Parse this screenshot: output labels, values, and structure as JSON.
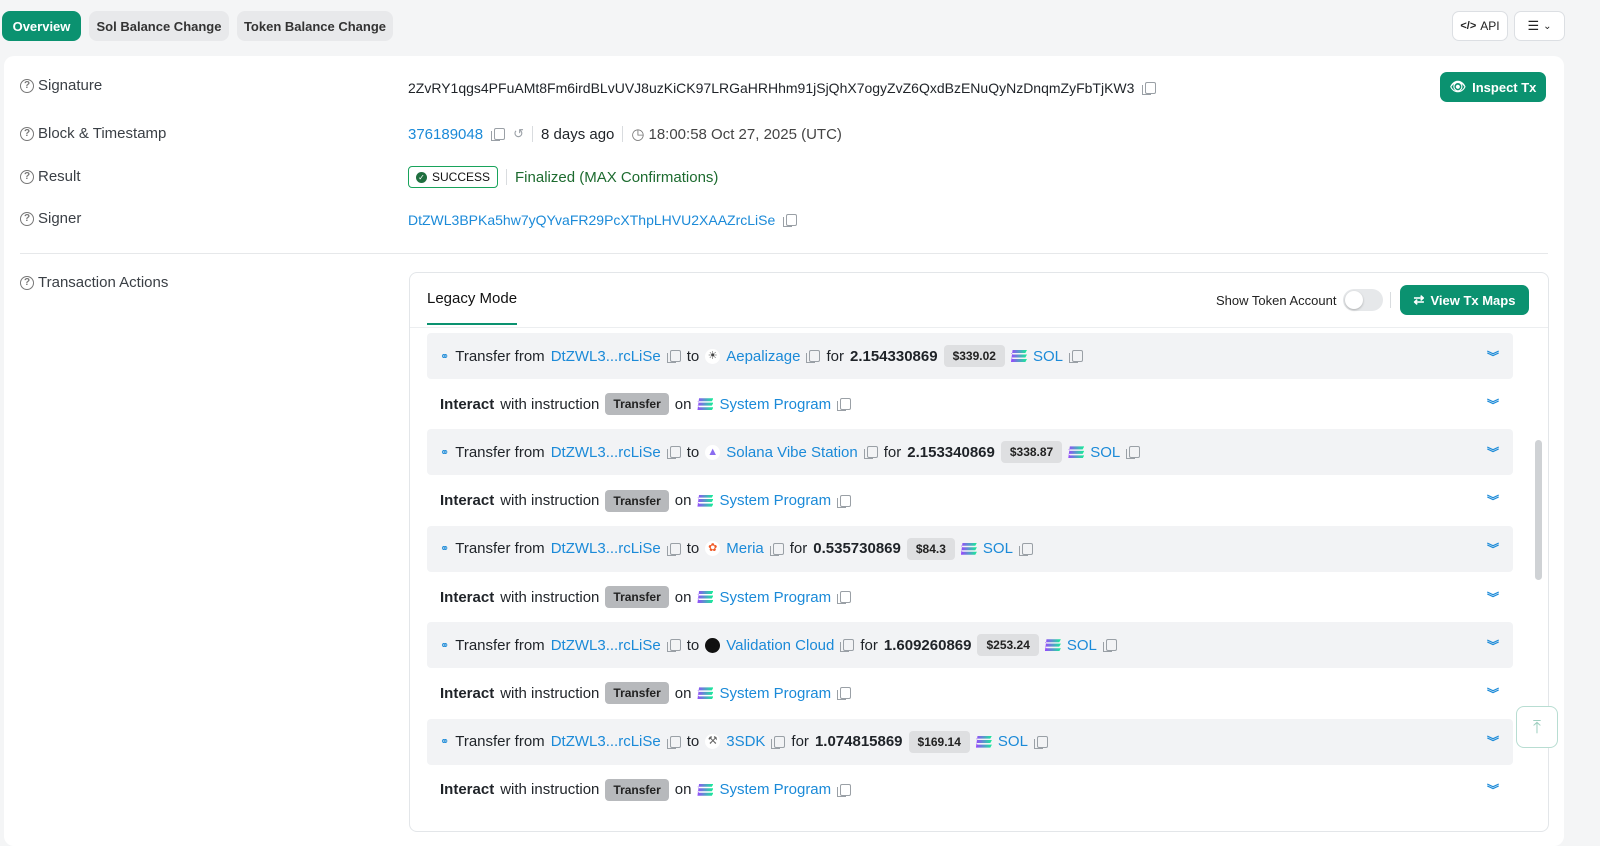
{
  "tabs": [
    {
      "label": "Overview",
      "active": true
    },
    {
      "label": "Sol Balance Change",
      "active": false
    },
    {
      "label": "Token Balance Change",
      "active": false
    }
  ],
  "toolbar": {
    "api_label": "API",
    "menu_icon": "list-icon"
  },
  "details": {
    "signature_label": "Signature",
    "signature_value": "2ZvRY1qgs4PFuAMt8Fm6irdBLvUVJ8uzKiCK97LRGaHRHhm91jSjQhX7ogyZvZ6QxdBzENuQyNzDnqmZyFbTjKW3",
    "inspect_label": "Inspect Tx",
    "block_label": "Block & Timestamp",
    "block_value": "376189048",
    "age": "8 days ago",
    "timestamp": "18:00:58 Oct 27, 2025 (UTC)",
    "result_label": "Result",
    "result_badge": "SUCCESS",
    "result_status": "Finalized (MAX Confirmations)",
    "signer_label": "Signer",
    "signer_value": "DtZWL3BPKa5hw7yQYvaFR29PcXThpLHVU2XAAZrcLiSe",
    "actions_label": "Transaction Actions"
  },
  "actions_panel": {
    "mode_tab": "Legacy Mode",
    "show_token_label": "Show Token Account",
    "show_token_on": false,
    "view_maps_label": "View Tx Maps"
  },
  "actions": [
    {
      "type": "transfer",
      "prefix": "Transfer from",
      "from": "DtZWL3...rcLiSe",
      "to_word": "to",
      "to": "Aepalizage",
      "to_icon": "aepalizage-icon",
      "for_word": "for",
      "amount": "2.154330869",
      "usd": "$339.02",
      "token": "SOL"
    },
    {
      "type": "interact",
      "bold": "Interact",
      "text": "with instruction",
      "instruction": "Transfer",
      "on_word": "on",
      "program": "System Program"
    },
    {
      "type": "transfer",
      "prefix": "Transfer from",
      "from": "DtZWL3...rcLiSe",
      "to_word": "to",
      "to": "Solana Vibe Station",
      "to_icon": "solana-vibe-station-icon",
      "for_word": "for",
      "amount": "2.153340869",
      "usd": "$338.87",
      "token": "SOL"
    },
    {
      "type": "interact",
      "bold": "Interact",
      "text": "with instruction",
      "instruction": "Transfer",
      "on_word": "on",
      "program": "System Program"
    },
    {
      "type": "transfer",
      "prefix": "Transfer from",
      "from": "DtZWL3...rcLiSe",
      "to_word": "to",
      "to": "Meria",
      "to_icon": "meria-icon",
      "for_word": "for",
      "amount": "0.535730869",
      "usd": "$84.3",
      "token": "SOL"
    },
    {
      "type": "interact",
      "bold": "Interact",
      "text": "with instruction",
      "instruction": "Transfer",
      "on_word": "on",
      "program": "System Program"
    },
    {
      "type": "transfer",
      "prefix": "Transfer from",
      "from": "DtZWL3...rcLiSe",
      "to_word": "to",
      "to": "Validation Cloud",
      "to_icon": "validation-cloud-icon",
      "for_word": "for",
      "amount": "1.609260869",
      "usd": "$253.24",
      "token": "SOL"
    },
    {
      "type": "interact",
      "bold": "Interact",
      "text": "with instruction",
      "instruction": "Transfer",
      "on_word": "on",
      "program": "System Program"
    },
    {
      "type": "transfer",
      "prefix": "Transfer from",
      "from": "DtZWL3...rcLiSe",
      "to_word": "to",
      "to": "3SDK",
      "to_icon": "3sdk-icon",
      "for_word": "for",
      "amount": "1.074815869",
      "usd": "$169.14",
      "token": "SOL"
    },
    {
      "type": "interact",
      "bold": "Interact",
      "text": "with instruction",
      "instruction": "Transfer",
      "on_word": "on",
      "program": "System Program"
    }
  ],
  "colors": {
    "accent": "#0b9270",
    "link": "#1b8ad8",
    "success": "#18a35b"
  }
}
